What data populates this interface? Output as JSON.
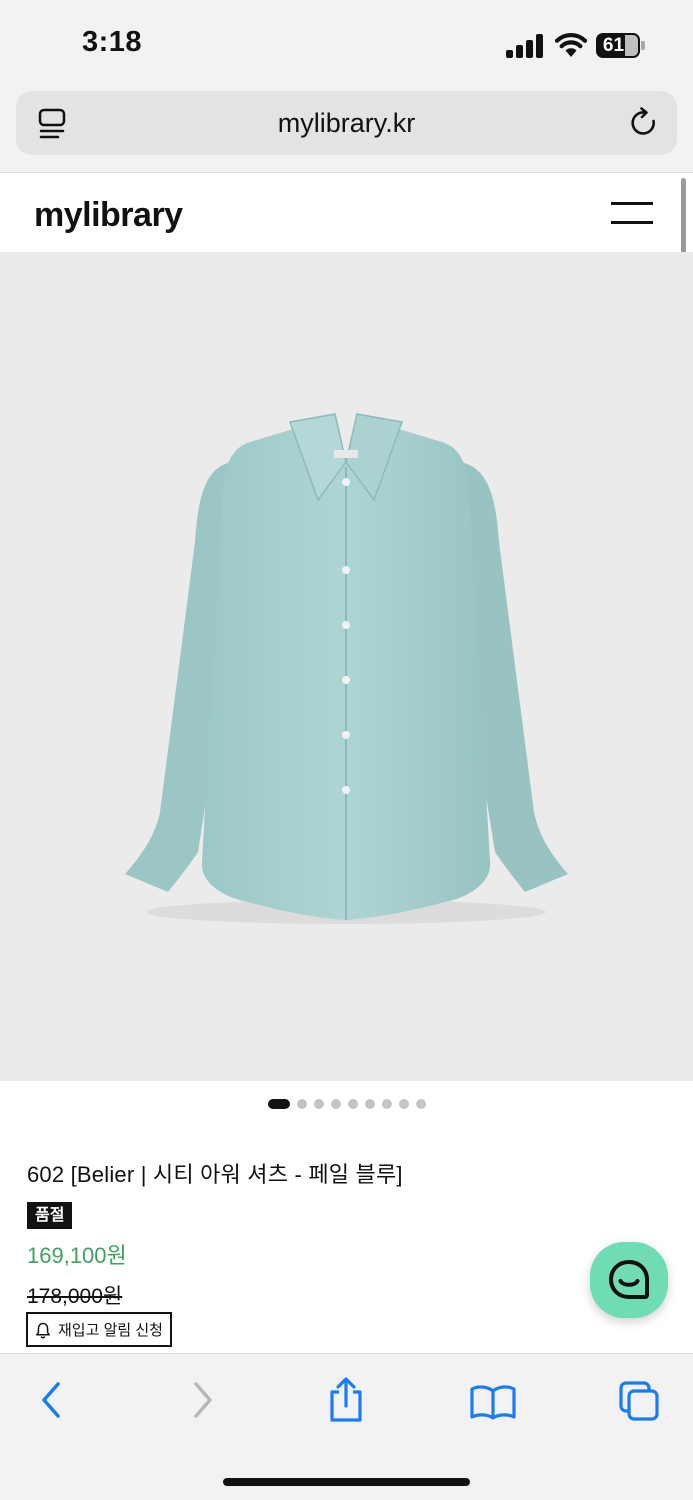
{
  "status_bar": {
    "time": "3:18",
    "battery_level": "61",
    "icons": [
      "signal-icon",
      "wifi-icon",
      "battery-icon"
    ]
  },
  "browser": {
    "url": "mylibrary.kr",
    "icons": [
      "reader-icon",
      "reload-icon"
    ]
  },
  "site": {
    "logo": "mylibrary",
    "menu_icon": "hamburger-icon"
  },
  "product": {
    "image_alt_icon": "shirt-image",
    "image_count": 9,
    "active_image_index": 0,
    "name": "602 [Belier | 시티 아워 셔츠 - 페일 블루]",
    "status_badge": "품절",
    "sale_price": "169,100원",
    "original_price": "178,000원",
    "restock_button": "재입고 알림 신청"
  },
  "chat": {
    "icon": "chat-icon"
  },
  "toolbar": {
    "items": [
      "back-icon",
      "forward-icon",
      "share-icon",
      "bookmarks-icon",
      "tabs-icon"
    ]
  },
  "colors": {
    "accent_price": "#3fa35b",
    "chat_button": "#6fdcb3",
    "ios_blue": "#1a7cf5",
    "image_background": "#ebebeb",
    "shirt": "#a6cfcf"
  }
}
